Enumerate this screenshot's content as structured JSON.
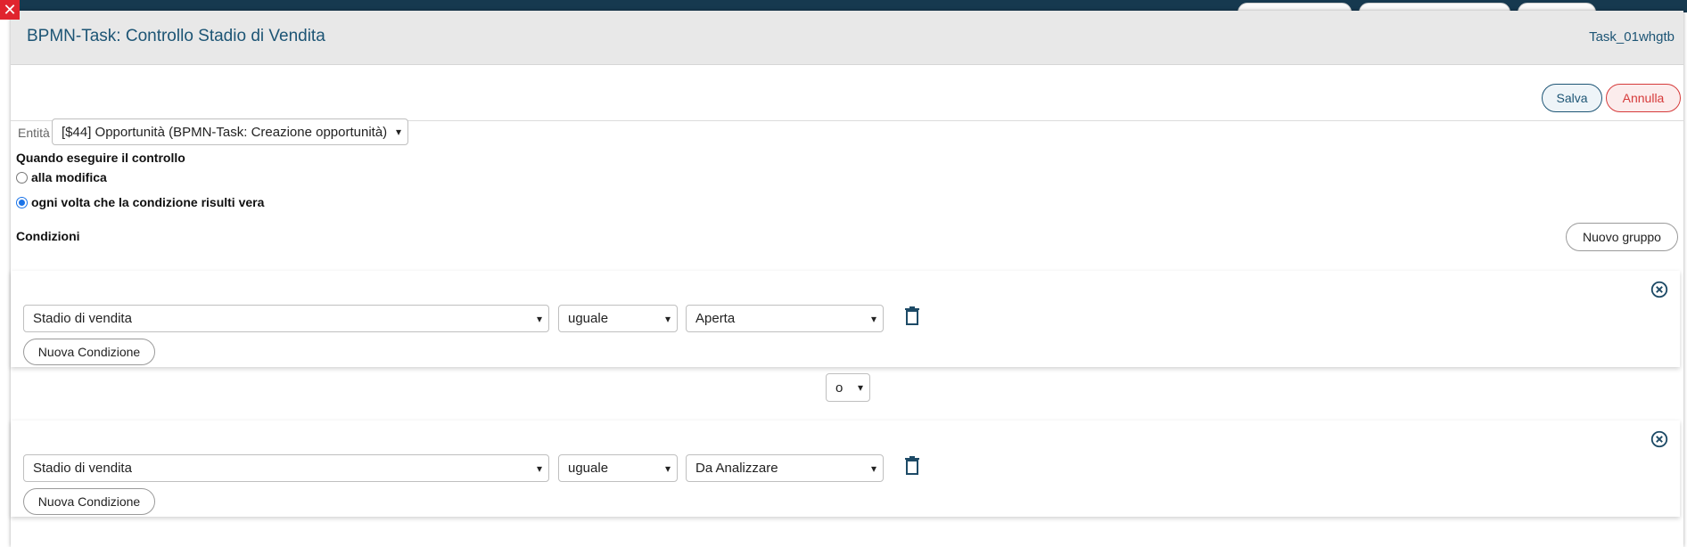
{
  "modal": {
    "title": "BPMN-Task: Controllo Stadio di Vendita",
    "task_id": "Task_01whgtb"
  },
  "toolbar": {
    "save_label": "Salva",
    "cancel_label": "Annulla"
  },
  "entity": {
    "label": "Entità",
    "selected": "[$44] Opportunità (BPMN-Task: Creazione opportunità)"
  },
  "when": {
    "title": "Quando eseguire il controllo",
    "options": [
      {
        "label": "alla modifica",
        "checked": false
      },
      {
        "label": "ogni volta che la condizione risulti vera",
        "checked": true
      }
    ]
  },
  "conditions": {
    "title": "Condizioni",
    "new_group_label": "Nuovo gruppo",
    "groups": [
      {
        "field": "Stadio di vendita",
        "operator": "uguale",
        "value": "Aperta",
        "new_condition_label": "Nuova Condizione"
      },
      {
        "field": "Stadio di vendita",
        "operator": "uguale",
        "value": "Da Analizzare",
        "new_condition_label": "Nuova Condizione"
      }
    ],
    "group_operator": "o"
  },
  "colors": {
    "accent": "#1d5575",
    "danger": "#d63a3a",
    "header_bg": "#e8e8e8"
  }
}
